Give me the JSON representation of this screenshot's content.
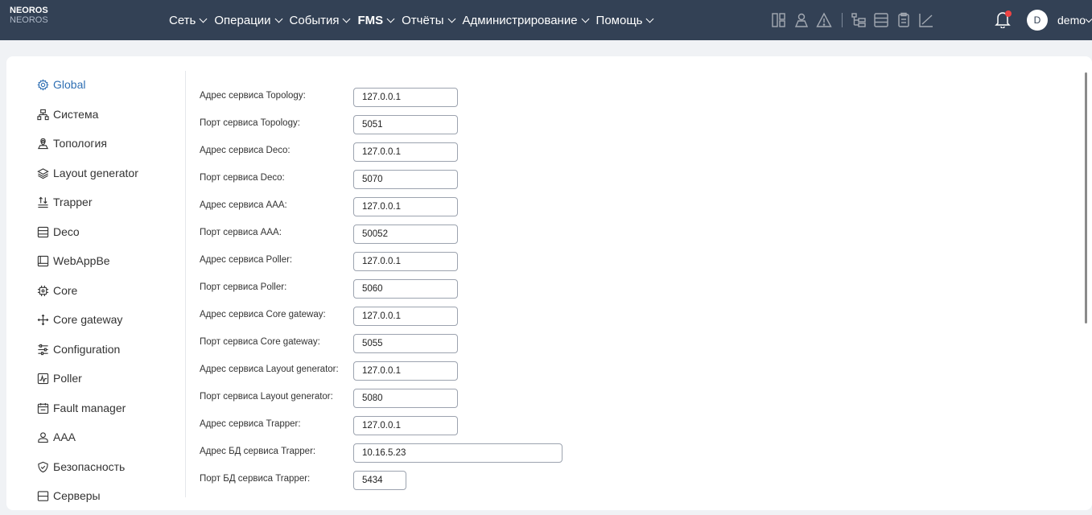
{
  "brand": {
    "line1": "NEOROS",
    "line2": "NEOROS"
  },
  "menu": [
    {
      "label": "Сеть",
      "active": false
    },
    {
      "label": "Операции",
      "active": false
    },
    {
      "label": "События",
      "active": false
    },
    {
      "label": "FMS",
      "active": true
    },
    {
      "label": "Отчёты",
      "active": false
    },
    {
      "label": "Администрирование",
      "active": false
    },
    {
      "label": "Помощь",
      "active": false
    }
  ],
  "toolbar_icons": [
    "grid-panel-icon",
    "users-map-icon",
    "warning-icon",
    "tree-list-icon",
    "table-list-icon",
    "clipboard-icon",
    "chart-line-icon"
  ],
  "user": {
    "avatar_letter": "D",
    "name": "demo"
  },
  "colors": {
    "topbar": "#334155",
    "accent": "#2f6fb3",
    "notification": "#ef4444"
  },
  "sidebar": {
    "items": [
      {
        "label": "Global",
        "icon": "gear-icon",
        "active": true
      },
      {
        "label": "Система",
        "icon": "network-icon",
        "active": false
      },
      {
        "label": "Топология",
        "icon": "location-icon",
        "active": false
      },
      {
        "label": "Layout generator",
        "icon": "layers-icon",
        "active": false
      },
      {
        "label": "Trapper",
        "icon": "trap-icon",
        "active": false
      },
      {
        "label": "Deco",
        "icon": "server-icon",
        "active": false
      },
      {
        "label": "WebAppBe",
        "icon": "window-icon",
        "active": false
      },
      {
        "label": "Core",
        "icon": "chip-icon",
        "active": false
      },
      {
        "label": "Core gateway",
        "icon": "arrows-icon",
        "active": false
      },
      {
        "label": "Configuration",
        "icon": "sliders-icon",
        "active": false
      },
      {
        "label": "Poller",
        "icon": "pulse-icon",
        "active": false
      },
      {
        "label": "Fault manager",
        "icon": "calendar-icon",
        "active": false
      },
      {
        "label": "AAA",
        "icon": "user-icon",
        "active": false
      },
      {
        "label": "Безопасность",
        "icon": "shield-icon",
        "active": false
      },
      {
        "label": "Серверы",
        "icon": "servers-icon",
        "active": false
      }
    ]
  },
  "form": {
    "fields": [
      {
        "label": "Адрес сервиса Topology:",
        "value": "127.0.0.1"
      },
      {
        "label": "Порт сервиса Topology:",
        "value": "5051"
      },
      {
        "label": "Адрес сервиса Deco:",
        "value": "127.0.0.1"
      },
      {
        "label": "Порт сервиса Deco:",
        "value": "5070"
      },
      {
        "label": "Адрес сервиса AAA:",
        "value": "127.0.0.1"
      },
      {
        "label": "Порт сервиса AAA:",
        "value": "50052"
      },
      {
        "label": "Адрес сервиса Poller:",
        "value": "127.0.0.1"
      },
      {
        "label": "Порт сервиса Poller:",
        "value": "5060"
      },
      {
        "label": "Адрес сервиса Core gateway:",
        "value": "127.0.0.1"
      },
      {
        "label": "Порт сервиса Core gateway:",
        "value": "5055"
      },
      {
        "label": "Адрес сервиса Layout generator:",
        "value": "127.0.0.1"
      },
      {
        "label": "Порт сервиса Layout generator:",
        "value": "5080"
      },
      {
        "label": "Адрес сервиса Trapper:",
        "value": "127.0.0.1"
      },
      {
        "label": "Адрес БД сервиса Trapper:",
        "value": "10.16.5.23"
      },
      {
        "label": "Порт БД сервиса Trapper:",
        "value": "5434"
      }
    ]
  }
}
